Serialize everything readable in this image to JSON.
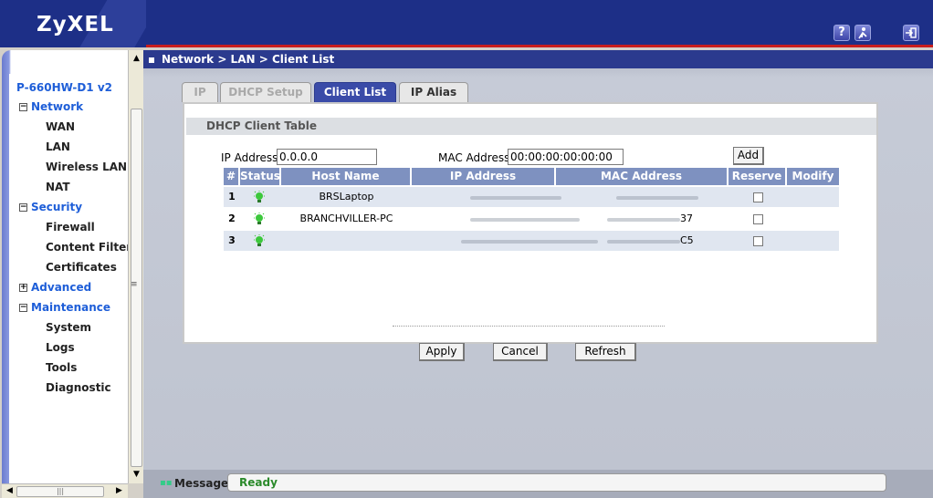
{
  "brand": {
    "logo": "ZyXEL"
  },
  "header": {
    "help_icon": "question-icon",
    "wizard_icon": "wizard-icon",
    "logout_icon": "logout-icon"
  },
  "sidebar": {
    "model": "P-660HW-D1 v2",
    "groups": [
      {
        "label": "Network",
        "expanded": true,
        "items": [
          "WAN",
          "LAN",
          "Wireless LAN",
          "NAT"
        ]
      },
      {
        "label": "Security",
        "expanded": true,
        "items": [
          "Firewall",
          "Content Filter",
          "Certificates"
        ]
      },
      {
        "label": "Advanced",
        "expanded": false,
        "items": []
      },
      {
        "label": "Maintenance",
        "expanded": true,
        "items": [
          "System",
          "Logs",
          "Tools",
          "Diagnostic"
        ]
      }
    ]
  },
  "breadcrumb": "Network > LAN > Client List",
  "tabs": [
    {
      "label": "IP",
      "state": "disabled"
    },
    {
      "label": "DHCP Setup",
      "state": "disabled"
    },
    {
      "label": "Client List",
      "state": "active"
    },
    {
      "label": "IP Alias",
      "state": "normal"
    }
  ],
  "panel": {
    "title": "DHCP Client Table",
    "ip_label": "IP Address",
    "ip_value": "0.0.0.0",
    "mac_label": "MAC Address",
    "mac_value": "00:00:00:00:00:00",
    "add_label": "Add"
  },
  "table": {
    "headers": [
      "#",
      "Status",
      "Host Name",
      "IP Address",
      "MAC Address",
      "Reserve",
      "Modify"
    ],
    "rows": [
      {
        "num": "1",
        "host": "BRSLaptop",
        "mac_suffix": "",
        "reserve": false
      },
      {
        "num": "2",
        "host": "BRANCHVILLER-PC",
        "mac_suffix": "37",
        "reserve": false
      },
      {
        "num": "3",
        "host": "",
        "mac_suffix": "C5",
        "reserve": false
      }
    ]
  },
  "actions": {
    "apply": "Apply",
    "cancel": "Cancel",
    "refresh": "Refresh"
  },
  "status": {
    "label": "Message",
    "text": "Ready"
  },
  "colors": {
    "header_blue": "#1d2f87",
    "header_red": "#c81e1e",
    "nav_blue": "#1e5ed8",
    "ready_green": "#2b8a2b"
  }
}
